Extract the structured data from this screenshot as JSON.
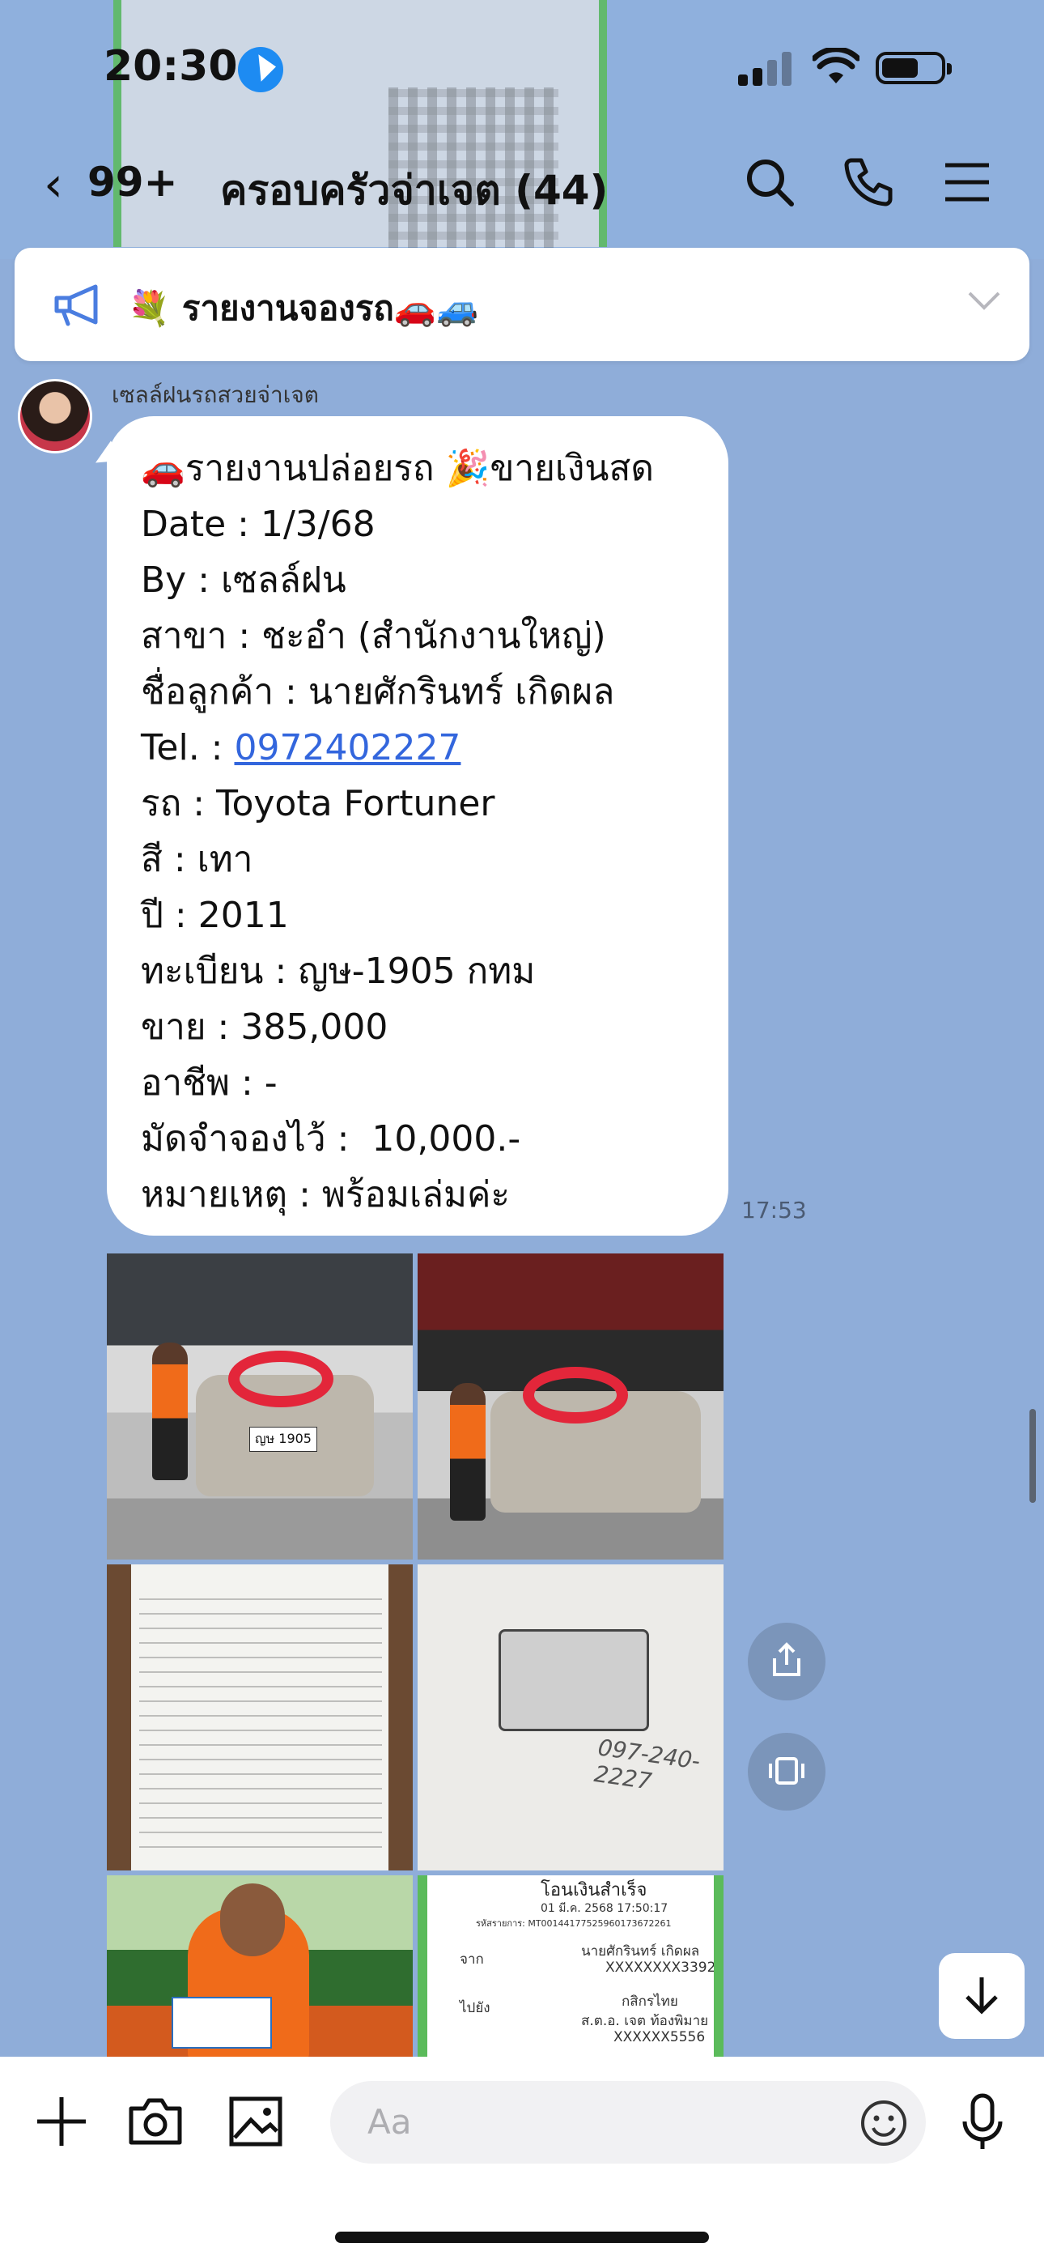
{
  "status_bar": {
    "time": "20:30"
  },
  "header": {
    "back_icon": "chevron-left-icon",
    "unread_count": "99+",
    "title": "ครอบครัวจ่าเจต (44)",
    "actions": [
      "search-icon",
      "phone-icon",
      "menu-icon"
    ]
  },
  "announcement": {
    "icon": "megaphone-icon",
    "text": "💐 รายงานจองรถ🚗🚙"
  },
  "message": {
    "sender": "เซลล์ฝนรถสวยจ่าเจต",
    "lines": {
      "l1": "🚗รายงานปล่อยรถ 🎉ขายเงินสด",
      "l2": "Date : 1/3/68",
      "l3": "By : เซลล์ฝน",
      "l4": "สาขา : ชะอำ (สำนักงานใหญ่)",
      "l5": "ชื่อลูกค้า : นายศักรินทร์ เกิดผล",
      "l6_label": "Tel. : ",
      "l6_phone": "0972402227",
      "l7": "รถ : Toyota Fortuner",
      "l8": "สี : เทา",
      "l9": "ปี : 2011",
      "l10": "ทะเบียน : ญษ-1905 กทม",
      "l11": "ขาย : 385,000",
      "l12": "อาชีพ : -",
      "l13": "มัดจำจองไว้ :  10,000.-",
      "l14": "หมายเหตุ : พร้อมเล่มค่ะ"
    },
    "time": "17:53"
  },
  "photos": {
    "plate1": "ญษ 1905",
    "id_note": "097-240-2227",
    "receipt": {
      "title": "โอนเงินสำเร็จ",
      "date": "01 มี.ค. 2568 17:50:17",
      "ref": "รหัสรายการ: MT00144177525960173672261",
      "from_label": "จาก",
      "from_name": "นายศักรินทร์ เกิดผล",
      "from_acct": "XXXXXXXX3392",
      "to_label": "ไปยัง",
      "to_bank": "กสิกรไทย",
      "to_name": "ส.ต.อ. เจต ท้องพิมาย",
      "to_acct": "XXXXXX5556"
    }
  },
  "floating": [
    "share-icon",
    "screenshot-icon",
    "arrow-down-icon"
  ],
  "input": {
    "placeholder": "Aa",
    "icons": [
      "plus-icon",
      "camera-icon",
      "image-icon",
      "emoji-icon",
      "microphone-icon"
    ]
  }
}
